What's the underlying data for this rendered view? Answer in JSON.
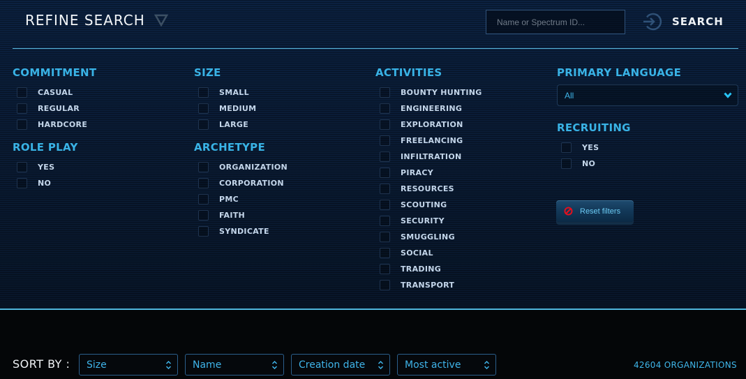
{
  "header": {
    "title": "REFINE SEARCH",
    "search_placeholder": "Name or Spectrum ID...",
    "search_value": "",
    "search_button_label": "SEARCH"
  },
  "colors": {
    "accent": "#39b3e6",
    "divider": "#5ab9de",
    "reset_icon": "#e3101e"
  },
  "filters": {
    "commitment": {
      "title": "COMMITMENT",
      "options": [
        {
          "label": "CASUAL",
          "checked": false
        },
        {
          "label": "REGULAR",
          "checked": false
        },
        {
          "label": "HARDCORE",
          "checked": false
        }
      ]
    },
    "role_play": {
      "title": "ROLE PLAY",
      "options": [
        {
          "label": "YES",
          "checked": false
        },
        {
          "label": "NO",
          "checked": false
        }
      ]
    },
    "size": {
      "title": "SIZE",
      "options": [
        {
          "label": "SMALL",
          "checked": false
        },
        {
          "label": "MEDIUM",
          "checked": false
        },
        {
          "label": "LARGE",
          "checked": false
        }
      ]
    },
    "archetype": {
      "title": "ARCHETYPE",
      "options": [
        {
          "label": "ORGANIZATION",
          "checked": false
        },
        {
          "label": "CORPORATION",
          "checked": false
        },
        {
          "label": "PMC",
          "checked": false
        },
        {
          "label": "FAITH",
          "checked": false
        },
        {
          "label": "SYNDICATE",
          "checked": false
        }
      ]
    },
    "activities": {
      "title": "ACTIVITIES",
      "options": [
        {
          "label": "BOUNTY HUNTING",
          "checked": false
        },
        {
          "label": "ENGINEERING",
          "checked": false
        },
        {
          "label": "EXPLORATION",
          "checked": false
        },
        {
          "label": "FREELANCING",
          "checked": false
        },
        {
          "label": "INFILTRATION",
          "checked": false
        },
        {
          "label": "PIRACY",
          "checked": false
        },
        {
          "label": "RESOURCES",
          "checked": false
        },
        {
          "label": "SCOUTING",
          "checked": false
        },
        {
          "label": "SECURITY",
          "checked": false
        },
        {
          "label": "SMUGGLING",
          "checked": false
        },
        {
          "label": "SOCIAL",
          "checked": false
        },
        {
          "label": "TRADING",
          "checked": false
        },
        {
          "label": "TRANSPORT",
          "checked": false
        }
      ]
    },
    "primary_language": {
      "title": "PRIMARY LANGUAGE",
      "selected": "All"
    },
    "recruiting": {
      "title": "RECRUITING",
      "options": [
        {
          "label": "YES",
          "checked": false
        },
        {
          "label": "NO",
          "checked": false
        }
      ]
    },
    "reset_label": "Reset filters"
  },
  "sort": {
    "label": "SORT BY :",
    "selects": [
      {
        "name": "size",
        "value": "Size"
      },
      {
        "name": "name",
        "value": "Name"
      },
      {
        "name": "creation-date",
        "value": "Creation date"
      },
      {
        "name": "most-active",
        "value": "Most active"
      }
    ]
  },
  "results": {
    "count_text": "42604 ORGANIZATIONS"
  }
}
